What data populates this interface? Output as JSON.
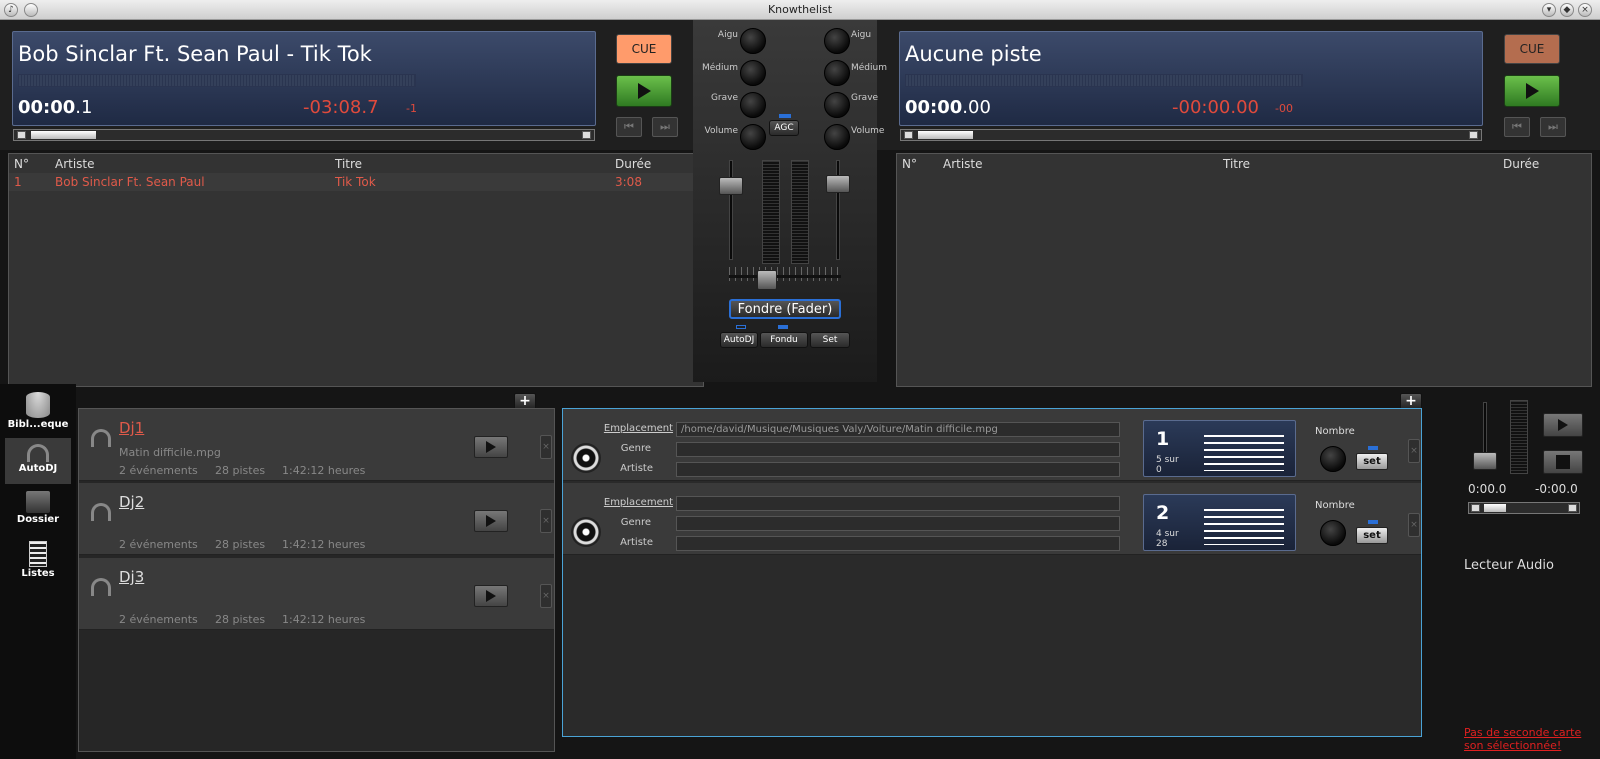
{
  "window": {
    "title": "Knowthelist"
  },
  "deck_left": {
    "track": "Bob Sinclar Ft. Sean Paul - Tik Tok",
    "time_main": "00:00",
    "time_frac": ".1",
    "remaining": "-03:08.7",
    "small": "-1",
    "cue": "CUE",
    "cue_color": "#ff9b6b"
  },
  "deck_right": {
    "track": "Aucune piste",
    "time_main": "00:00",
    "time_frac": ".00",
    "remaining": "-00:00.00",
    "small": "-00",
    "cue": "CUE",
    "cue_color": "#b46d4f"
  },
  "playlist_left": {
    "headers": {
      "num": "N°",
      "artist": "Artiste",
      "title": "Titre",
      "duration": "Durée"
    },
    "rows": [
      {
        "num": "1",
        "artist": "Bob Sinclar Ft. Sean Paul",
        "title": "Tik Tok",
        "duration": "3:08"
      }
    ]
  },
  "playlist_right": {
    "headers": {
      "num": "N°",
      "artist": "Artiste",
      "title": "Titre",
      "duration": "Durée"
    }
  },
  "mixer": {
    "aigu": "Aigu",
    "medium": "Médium",
    "grave": "Grave",
    "volume": "Volume",
    "agc": "AGC",
    "fader": "Fondre (Fader)",
    "autodj": "AutoDJ",
    "fondu": "Fondu",
    "set": "Set"
  },
  "sidebar": {
    "items": [
      {
        "label": "Bibl...eque",
        "icon": "database-icon"
      },
      {
        "label": "AutoDJ",
        "icon": "headphones-icon"
      },
      {
        "label": "Dossier",
        "icon": "folder-icon"
      },
      {
        "label": "Listes",
        "icon": "list-icon"
      }
    ]
  },
  "djs": [
    {
      "name": "Dj1",
      "file": "Matin difficile.mpg",
      "events": "2 événements",
      "tracks": "28 pistes",
      "duration": "1:42:12 heures",
      "active": true
    },
    {
      "name": "Dj2",
      "file": "",
      "events": "2 événements",
      "tracks": "28 pistes",
      "duration": "1:42:12 heures"
    },
    {
      "name": "Dj3",
      "file": "",
      "events": "2 événements",
      "tracks": "28 pistes",
      "duration": "1:42:12 heures"
    }
  ],
  "events": [
    {
      "emplacement_label": "Emplacement",
      "emplacement": "/home/david/Musique/Musiques Valy/Voiture/Matin difficile.mpg",
      "genre_label": "Genre",
      "artiste_label": "Artiste",
      "num": "1",
      "count_line1": "5 sur",
      "count_line2": "0",
      "nombre": "Nombre",
      "set": "set"
    },
    {
      "emplacement_label": "Emplacement",
      "emplacement": "",
      "genre_label": "Genre",
      "artiste_label": "Artiste",
      "num": "2",
      "count_line1": "4 sur",
      "count_line2": "28",
      "nombre": "Nombre",
      "set": "set"
    }
  ],
  "player": {
    "elapsed": "0:00.0",
    "remaining": "-0:00.0",
    "label": "Lecteur Audio",
    "warning": "Pas de seconde carte son sélectionnée!"
  },
  "plus": "+"
}
